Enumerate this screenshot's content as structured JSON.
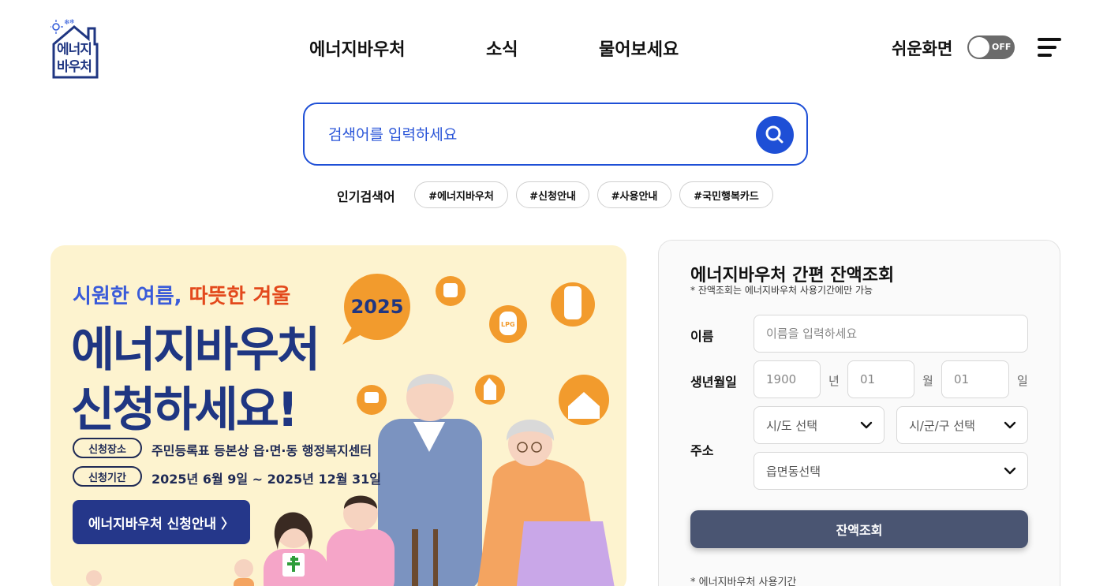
{
  "header": {
    "logo_text_line1": "에너지",
    "logo_text_line2": "바우처",
    "nav": [
      "에너지바우처",
      "소식",
      "물어보세요"
    ],
    "easy_screen_label": "쉬운화면",
    "toggle_state": "OFF"
  },
  "search": {
    "placeholder": "검색어를 입력하세요",
    "popular_label": "인기검색어",
    "tags": [
      "#에너지바우처",
      "#신청안내",
      "#사용안내",
      "#국민행복카드"
    ]
  },
  "banner": {
    "subtitle_cool": "시원한 여름,",
    "subtitle_warm": "따뜻한 겨울",
    "year": "2025",
    "title_line1": "에너지바우처",
    "title_line2": "신청하세요!",
    "place_label": "신청장소",
    "place_text": "주민등록표 등본상 읍·면·동 행정복지센터",
    "period_label": "신청기간",
    "period_text": "2025년 6월 9일 ~ 2025년 12월 31일",
    "button_label": "에너지바우처 신청안내 〉",
    "lpg_label": "LPG"
  },
  "balance": {
    "title": "에너지바우처 간편 잔액조회",
    "note": "* 잔액조회는 에너지바우처 사용기간에만 가능",
    "name_label": "이름",
    "name_placeholder": "이름을 입력하세요",
    "birth_label": "생년월일",
    "birth_year": "1900",
    "birth_year_unit": "년",
    "birth_month": "01",
    "birth_month_unit": "월",
    "birth_day": "01",
    "birth_day_unit": "일",
    "address_label": "주소",
    "sido": "시/도 선택",
    "sigungu": "시/군/구 선택",
    "eupmyeondong": "읍면동선택",
    "submit_label": "잔액조회",
    "footer_note": "* 에너지바우처 사용기간"
  },
  "colors": {
    "primary_blue": "#1e4fd6",
    "banner_bg": "#fdf3cf",
    "banner_navy": "#1f3682",
    "banner_orange": "#f29b2d",
    "query_button": "#4a5572"
  }
}
